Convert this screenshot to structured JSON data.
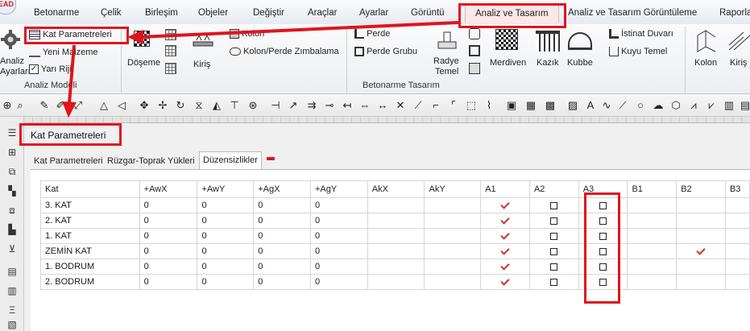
{
  "app": {
    "logo_text": "EAD"
  },
  "menu": {
    "items": [
      "Betonarme",
      "Çelik",
      "Birleşim",
      "Objeler",
      "Değiştir",
      "Araçlar",
      "Ayarlar",
      "Görüntü",
      "Analiz ve Tasarım",
      "Analiz ve Tasarım Görüntüleme",
      "Raporla"
    ],
    "active": "Analiz ve Tasarım"
  },
  "ribbon": {
    "analiz_modeli": {
      "group_label": "Analiz Modeli",
      "analiz_ayarlari_label_1": "Analiz",
      "analiz_ayarlari_label_2": "Ayarları",
      "kat_parametreleri": "Kat Parametreleri",
      "yeni_malzeme": "Yeni Malzeme",
      "yari_rijit": "Yarı Rijit"
    },
    "betonarme_tasarim": {
      "group_label": "Betonarme Tasarım",
      "doseme": "Döşeme",
      "kiris": "Kiriş",
      "kolon": "Kolon",
      "kolon_perde_zimbalama": "Kolon/Perde Zımbalama",
      "perde": "Perde",
      "perde_grubu": "Perde Grubu",
      "radye_temel_1": "Radye",
      "radye_temel_2": "Temel",
      "merdiven": "Merdiven",
      "kazik": "Kazık",
      "kubbe": "Kubbe",
      "istinat_duvari": "İstinat Duvarı",
      "kuyu_temel": "Kuyu Temel"
    },
    "celik_tasarim": {
      "kolon": "Kolon",
      "kiris": "Kiriş"
    }
  },
  "panel": {
    "title": "Kat Parametreleri",
    "tabs": [
      "Kat Parametreleri",
      "Rüzgar-Toprak Yükleri",
      "Düzensizlikler"
    ],
    "selected_tab": "Düzensizlikler"
  },
  "table": {
    "columns": [
      "Kat",
      "+AwX",
      "+AwY",
      "+AgX",
      "+AgY",
      "AkX",
      "AkY",
      "A1",
      "A2",
      "A3",
      "B1",
      "B2",
      "B3"
    ],
    "rows": [
      {
        "kat": "3. KAT",
        "awx": "0",
        "awy": "0",
        "agx": "0",
        "agy": "0",
        "akx": "",
        "aky": "",
        "a1": true,
        "a2": false,
        "a3": false,
        "b2": false
      },
      {
        "kat": "2. KAT",
        "awx": "0",
        "awy": "0",
        "agx": "0",
        "agy": "0",
        "akx": "",
        "aky": "",
        "a1": true,
        "a2": false,
        "a3": false,
        "b2": false
      },
      {
        "kat": "1. KAT",
        "awx": "0",
        "awy": "0",
        "agx": "0",
        "agy": "0",
        "akx": "",
        "aky": "",
        "a1": true,
        "a2": false,
        "a3": false,
        "b2": false
      },
      {
        "kat": "ZEMİN KAT",
        "awx": "0",
        "awy": "0",
        "agx": "0",
        "agy": "0",
        "akx": "",
        "aky": "",
        "a1": true,
        "a2": false,
        "a3": false,
        "b2": true
      },
      {
        "kat": "1. BODRUM",
        "awx": "0",
        "awy": "0",
        "agx": "0",
        "agy": "0",
        "akx": "",
        "aky": "",
        "a1": true,
        "a2": false,
        "a3": false,
        "b2": false
      },
      {
        "kat": "2. BODRUM",
        "awx": "0",
        "awy": "0",
        "agx": "0",
        "agy": "0",
        "akx": "",
        "aky": "",
        "a1": true,
        "a2": false,
        "a3": false,
        "b2": false
      }
    ]
  },
  "colors": {
    "annotation": "#e0141e",
    "checkmark": "#d32f2f",
    "active_tab_bg": "#fde7e7"
  }
}
